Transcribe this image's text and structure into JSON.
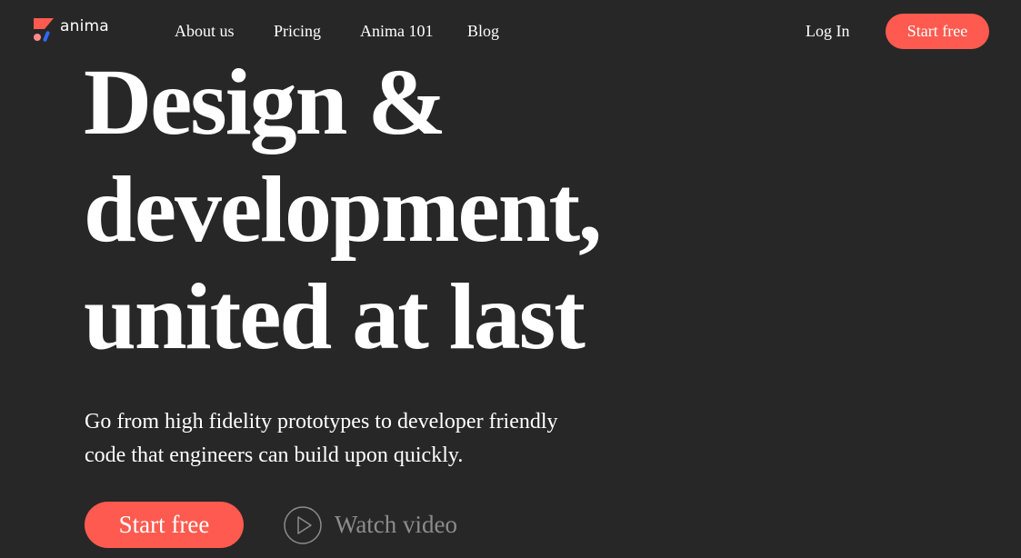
{
  "brand": {
    "name": "anima",
    "logo_icon": "anima-logo-icon",
    "colors": {
      "red": "#ff5a4f",
      "blue": "#2d6bf5",
      "pink": "#ff8a8a"
    }
  },
  "header": {
    "nav": [
      "About us",
      "Pricing",
      "Anima 101",
      "Blog"
    ],
    "login_label": "Log In",
    "cta_label": "Start free"
  },
  "hero": {
    "headline_lines": [
      "Design &",
      "development,",
      "united at last"
    ],
    "subtitle_lines": [
      "Go from high fidelity prototypes to developer friendly",
      "code that engineers can build upon quickly."
    ],
    "cta_label": "Start free",
    "video_label": "Watch video",
    "video_icon": "play-circle-icon"
  },
  "theme": {
    "background": "#272727",
    "accent": "#ff5a4f",
    "muted_text": "#8c8c8c"
  }
}
